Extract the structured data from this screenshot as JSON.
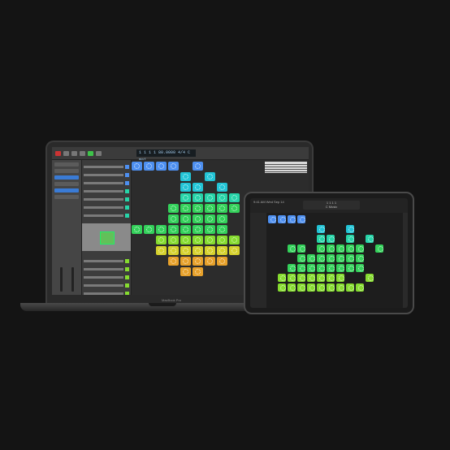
{
  "laptop": {
    "brand_label": "MacBook Pro",
    "lcd_text": "1  1  1  1   80.0000   4/4   C maj",
    "window": "Logic Pro"
  },
  "ipad": {
    "status_text": "9:41 AM  Wed Sep 14",
    "lcd_line1": "1  1  1  1",
    "lcd_line2": "C  Music"
  },
  "colors": {
    "blue": "#4d8ff0",
    "cyan": "#22c4d6",
    "teal": "#26d4a8",
    "green": "#33d15a",
    "lime": "#86dc2f",
    "yellow": "#d6d12c",
    "orange": "#e7a12b"
  }
}
